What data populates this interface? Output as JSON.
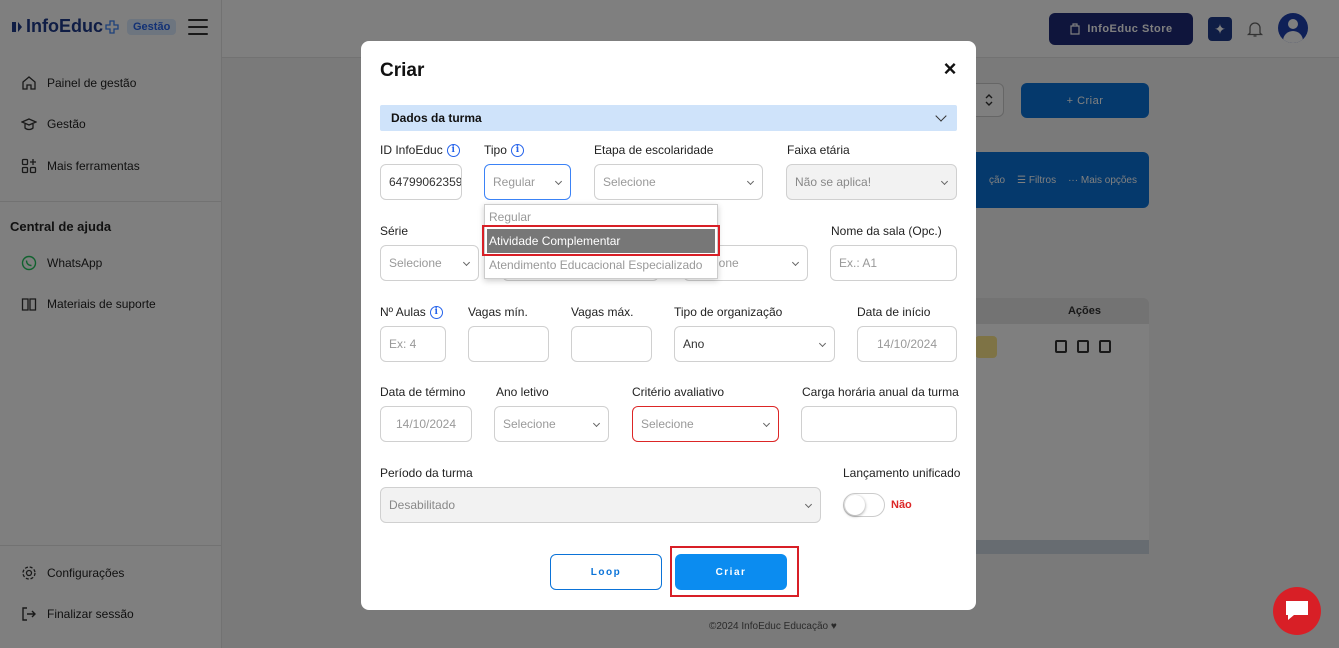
{
  "app": {
    "logo": "InfoEduc",
    "badge": "Gestão",
    "store_button": "InfoEduc Store",
    "footer": "©2024 InfoEduc Educação"
  },
  "sidebar": {
    "items": [
      {
        "label": "Painel de gestão",
        "icon": "home-icon"
      },
      {
        "label": "Gestão",
        "icon": "graduation-cap-icon"
      },
      {
        "label": "Mais ferramentas",
        "icon": "grid-plus-icon"
      }
    ],
    "help_title": "Central de ajuda",
    "help_items": [
      {
        "label": "WhatsApp",
        "icon": "whatsapp-icon"
      },
      {
        "label": "Materiais de suporte",
        "icon": "book-icon"
      }
    ],
    "bottom_items": [
      {
        "label": "Configurações",
        "icon": "gear-icon"
      },
      {
        "label": "Finalizar sessão",
        "icon": "logout-icon"
      }
    ]
  },
  "background": {
    "criar_button": "+ Criar",
    "bar_items": [
      "ção",
      "Filtros",
      "Mais opções"
    ],
    "table_header": "Ações"
  },
  "modal": {
    "title": "Criar",
    "close": "×",
    "section": "Dados da turma",
    "fields": {
      "id_label": "ID InfoEduc",
      "id_value": "64799062359",
      "tipo_label": "Tipo",
      "tipo_value": "Regular",
      "etapa_label": "Etapa de escolaridade",
      "etapa_value": "Selecione",
      "faixa_label": "Faixa etária",
      "faixa_value": "Não se aplica!",
      "serie_label": "Série",
      "serie_value": "Selecione",
      "hidden_select_value": "ione",
      "sala_label": "Nome da sala (Opc.)",
      "sala_placeholder": "Ex.: A1",
      "aulas_label": "Nº Aulas",
      "aulas_placeholder": "Ex: 4",
      "vagas_min_label": "Vagas mín.",
      "vagas_max_label": "Vagas máx.",
      "organizacao_label": "Tipo de organização",
      "organizacao_value": "Ano",
      "inicio_label": "Data de início",
      "inicio_value": "14/10/2024",
      "termino_label": "Data de término",
      "termino_value": "14/10/2024",
      "ano_label": "Ano letivo",
      "ano_value": "Selecione",
      "criterio_label": "Critério avaliativo",
      "criterio_value": "Selecione",
      "carga_label": "Carga horária anual da turma",
      "periodo_label": "Período da turma",
      "periodo_value": "Desabilitado",
      "lancamento_label": "Lançamento unificado",
      "lancamento_value": "Não"
    },
    "tipo_options": [
      "Regular",
      "Atividade Complementar",
      "Atendimento Educacional Especializado"
    ],
    "tipo_highlighted": "Atividade Complementar",
    "loop_button": "Loop",
    "create_button": "Criar"
  }
}
